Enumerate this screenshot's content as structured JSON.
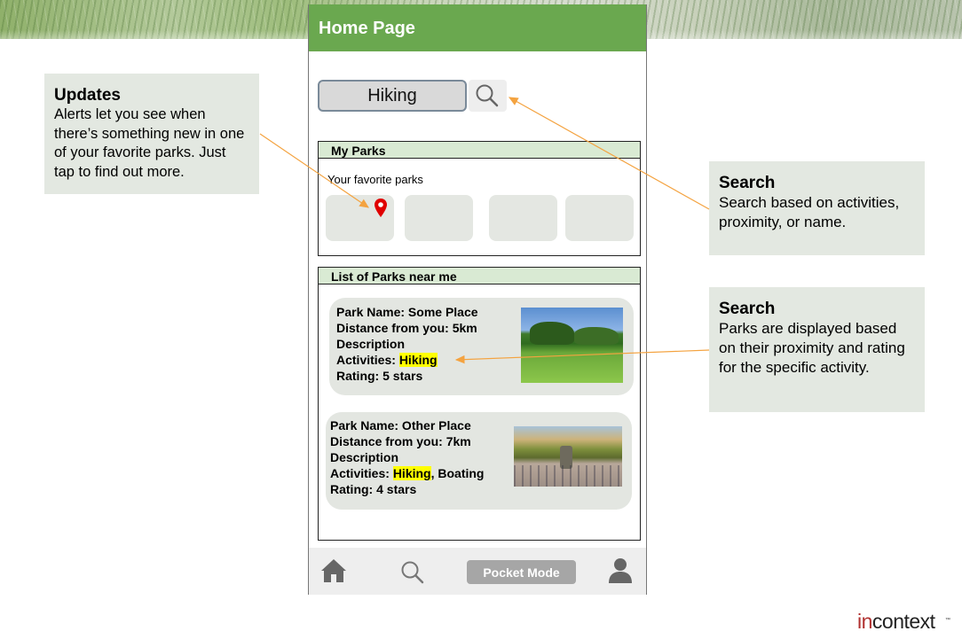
{
  "phone": {
    "title": "Home Page",
    "search": {
      "value": "Hiking",
      "icon": "search-icon"
    },
    "my_parks": {
      "heading": "My Parks",
      "subtitle": "Your favorite parks",
      "alert_icon": "map-pin-icon",
      "alert_color": "#e00000"
    },
    "nearby": {
      "heading": "List of Parks near me",
      "parks": [
        {
          "name_line": "Park Name: Some Place",
          "distance_line": "Distance from you: 5km",
          "description": "Description",
          "activities_prefix": "Activities: ",
          "activity_highlight": "Hiking",
          "activities_suffix": "",
          "rating_line": "Rating: 5 stars"
        },
        {
          "name_line": "Park Name: Other Place",
          "distance_line": "Distance from you: 7km",
          "description": "Description",
          "activities_prefix": "Activities: ",
          "activity_highlight": "Hiking",
          "activities_suffix": ", Boating",
          "rating_line": "Rating: 4 stars"
        }
      ]
    },
    "navbar": {
      "home_icon": "home-icon",
      "search_icon": "search-icon",
      "pocket_mode_label": "Pocket Mode",
      "profile_icon": "user-icon"
    }
  },
  "callouts": {
    "updates": {
      "title": "Updates",
      "text": "Alerts let you see when there’s something new in one of your favorite parks. Just tap to find out more."
    },
    "search_1": {
      "title": "Search",
      "text": "Search based on activities, proximity, or name."
    },
    "search_2": {
      "title": "Search",
      "text": "Parks are displayed based on their proximity and rating for the specific activity."
    }
  },
  "logo": {
    "prefix": "in",
    "rest": "context",
    "mark": "™"
  },
  "colors": {
    "header_green": "#6aa84f",
    "section_head_green": "#d9ead3",
    "highlight_yellow": "#ffff00",
    "arrow_orange": "#f4a340",
    "callout_bg": "#e3e8e1"
  }
}
